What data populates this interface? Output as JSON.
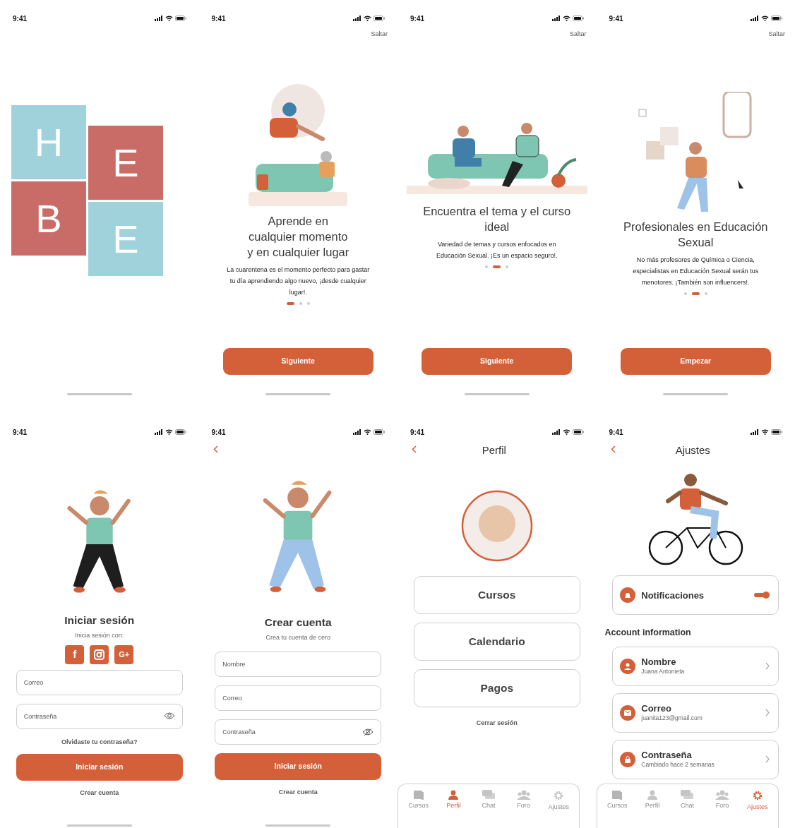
{
  "screens": [
    {
      "kind": "splash",
      "time": "9:41",
      "logo_letters": [
        "H",
        "E",
        "B",
        "E"
      ]
    },
    {
      "kind": "onboarding",
      "time": "9:41",
      "skip": "Saltar",
      "title": "Aprende en\ncualquier momento\ny en cualquier lugar",
      "body": "La cuarentena es el momento perfecto para gastar\ntu día aprendiendo algo nuevo, ¡desde cualquier\nlugar!.",
      "dots": [
        {
          "selected": true
        },
        {
          "selected": false
        },
        {
          "selected": false
        }
      ],
      "button": "Siguiente"
    },
    {
      "kind": "onboarding",
      "time": "9:41",
      "skip": "Saltar",
      "title": "Encuentra el tema y el curso\nideal",
      "body": "Variedad de temas y cursos enfocados en\nEducación Sexual. ¡Es un espacio seguro!.",
      "dots": [
        {
          "selected": false
        },
        {
          "selected": true
        },
        {
          "selected": false
        }
      ],
      "button": "Siguiente"
    },
    {
      "kind": "onboarding",
      "time": "9:41",
      "skip": "Saltar",
      "title": "Profesionales en Educación\nSexual",
      "body": "No más profesores de Química o Ciencia,\nespecialistas en Educación Sexual serán tus\nmenotores. ¡También son influencers!.",
      "dots": [
        {
          "selected": false
        },
        {
          "selected": true
        },
        {
          "selected": false
        }
      ],
      "button": "Empezar"
    },
    {
      "kind": "login",
      "time": "9:41",
      "title": "Iniciar sesión",
      "subtitle": "Inicia sesión con:",
      "social": [
        "f",
        "G+"
      ],
      "fields": [
        {
          "kind": "text",
          "placeholder": "Correo"
        },
        {
          "kind": "password",
          "placeholder": "Contraseña",
          "visible": true
        }
      ],
      "forgot": "Olvidaste tu contraseña?",
      "button": "Iniciar sesión",
      "link": "Crear cuenta"
    },
    {
      "kind": "signup",
      "time": "9:41",
      "title": "Crear cuenta",
      "subtitle": "Crea tu cuenta de cero",
      "fields": [
        {
          "kind": "text",
          "placeholder": "Nombre"
        },
        {
          "kind": "text",
          "placeholder": "Correo"
        },
        {
          "kind": "password",
          "placeholder": "Contraseña",
          "visible": false
        }
      ],
      "button": "Iniciar sesión",
      "link": "Crear cuenta"
    },
    {
      "kind": "profile",
      "time": "9:41",
      "title": "Perfil",
      "menu": [
        "Cursos",
        "Calendario",
        "Pagos"
      ],
      "logout": "Cerrar sesión",
      "tabs": [
        {
          "label": "Cursos",
          "selected": false
        },
        {
          "label": "Perfil",
          "selected": true
        },
        {
          "label": "Chat",
          "selected": false
        },
        {
          "label": "Foro",
          "selected": false
        },
        {
          "label": "Ajustes",
          "selected": false
        }
      ]
    },
    {
      "kind": "settings",
      "time": "9:41",
      "title": "Ajustes",
      "notifications": {
        "label": "Notificaciones",
        "on": true
      },
      "section": "Account information",
      "rows": [
        {
          "label": "Nombre",
          "value": "Juana Antonieta"
        },
        {
          "label": "Correo",
          "value": "juanita123@gmail.com"
        },
        {
          "label": "Contraseña",
          "value": "Cambiado hace 2 semanas"
        }
      ],
      "tabs": [
        {
          "label": "Cursos",
          "selected": false
        },
        {
          "label": "Perfil",
          "selected": false
        },
        {
          "label": "Chat",
          "selected": false
        },
        {
          "label": "Foro",
          "selected": false
        },
        {
          "label": "Ajustes",
          "selected": true
        }
      ]
    }
  ]
}
